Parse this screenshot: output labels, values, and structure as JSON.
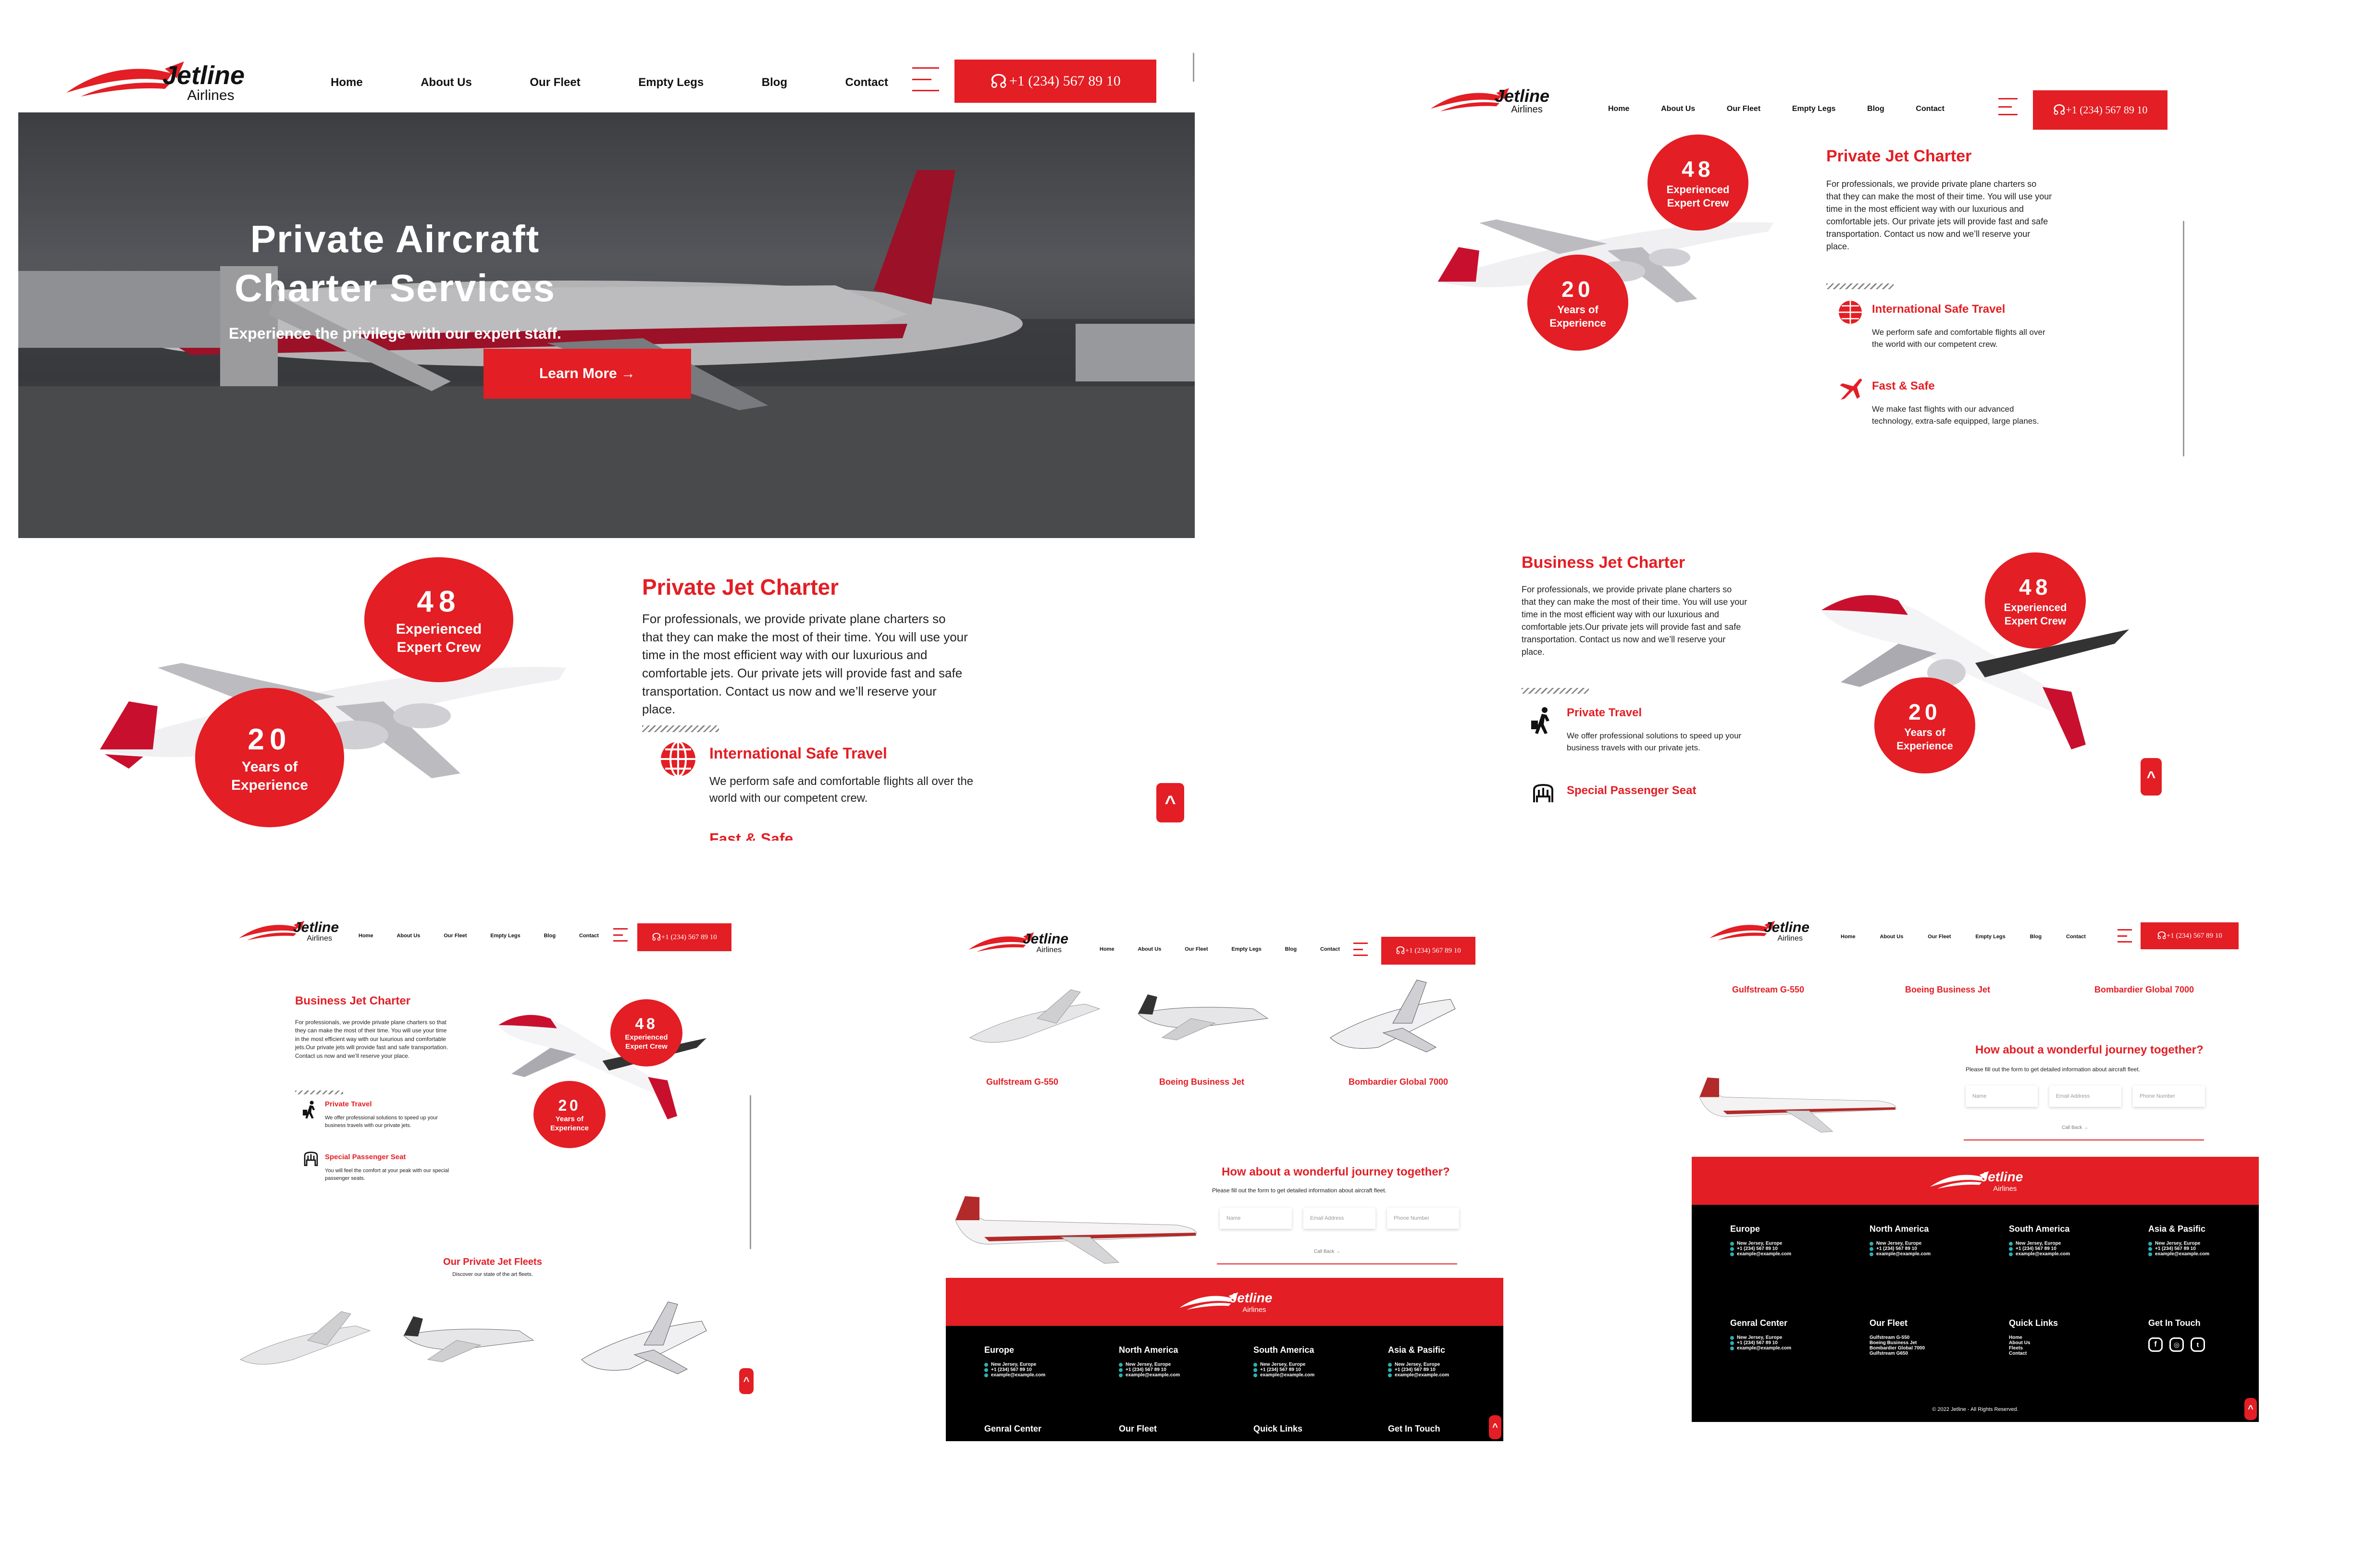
{
  "brand": {
    "name": "Jetline",
    "sub": "Airlines"
  },
  "nav": {
    "items": [
      "Home",
      "About Us",
      "Our Fleet",
      "Empty Legs",
      "Blog",
      "Contact"
    ],
    "phone": "+1 (234) 567 89 10"
  },
  "hero": {
    "title_line1": "Private Aircraft",
    "title_line2": "Charter Services",
    "subtitle": "Experience the privilege with our expert staff.",
    "button": "Learn More →"
  },
  "stats": {
    "crew_num": "48",
    "crew_label1": "Experienced",
    "crew_label2": "Expert Crew",
    "years_num": "20",
    "years_label1": "Years of",
    "years_label2": "Experience"
  },
  "private": {
    "title": "Private Jet Charter",
    "text": "For professionals, we provide private plane charters so that they can make the most of their time. You will use your time in the most efficient way with our luxurious and comfortable jets. Our private jets will provide fast and safe transportation. Contact us now and we’ll reserve your place.",
    "f1_title": "International Safe Travel",
    "f1_text": "We perform safe and comfortable flights all over the world with our competent crew.",
    "f2_title": "Fast & Safe",
    "f2_text": "We make fast flights with our advanced technology, extra-safe equipped, large planes."
  },
  "business": {
    "title": "Business Jet Charter",
    "text": "For professionals, we provide private plane charters so that they can make the most of their time. You will use your time in the most efficient way with our luxurious and comfortable jets.Our private jets will provide fast and safe transportation. Contact us now and we’ll reserve your place.",
    "f1_title": "Private Travel",
    "f1_text": "We offer professional solutions to speed up your business travels with our private jets.",
    "f2_title": "Special Passenger Seat",
    "f2_text": "You will feel the comfort at your peak with our special passenger seats."
  },
  "fleets": {
    "title": "Our Private Jet Fleets",
    "subtitle": "Discover our state of the art fleets.",
    "names": [
      "Gulfstream G-550",
      "Boeing Business Jet",
      "Bombardier Global 7000"
    ]
  },
  "journey": {
    "title": "How about a wonderful journey together?",
    "text": "Please fill out the form to get detailed information about aircraft fleet.",
    "name_ph": "Name",
    "email_ph": "Email Address",
    "phone_ph": "Phone Number",
    "button": "Call Back →"
  },
  "footer": {
    "regions": [
      {
        "title": "Europe",
        "addr": "New Jersey, Europe",
        "phone": "+1 (234) 567 89 10",
        "email": "example@example.com"
      },
      {
        "title": "North America",
        "addr": "New Jersey, Europe",
        "phone": "+1 (234) 567 89 10",
        "email": "example@example.com"
      },
      {
        "title": "South America",
        "addr": "New Jersey, Europe",
        "phone": "+1 (234) 567 89 10",
        "email": "example@example.com"
      },
      {
        "title": "Asia & Pasific",
        "addr": "New Jersey, Europe",
        "phone": "+1 (234) 567 89 10",
        "email": "example@example.com"
      }
    ],
    "center": {
      "title": "Genral Center",
      "addr": "New Jersey, Europe",
      "phone": "+1 (234) 567 89 10",
      "email": "example@example.com"
    },
    "fleet": {
      "title": "Our Fleet",
      "items": [
        "Gulfstream G-550",
        "Boeing Business Jet",
        "Bombardier Global 7000",
        "Gulfstream G650"
      ]
    },
    "links": {
      "title": "Quick Links",
      "items": [
        "Home",
        "About Us",
        "Fleets",
        "Contact"
      ]
    },
    "touch": {
      "title": "Get In Touch"
    },
    "copyright": "© 2022 Jetline - All Rights Reserved."
  },
  "colors": {
    "accent": "#e31e24",
    "footer": "#000000"
  },
  "icons": [
    "headset-icon",
    "globe-icon",
    "plane-icon",
    "traveler-icon",
    "seat-icon",
    "location-icon",
    "phone-icon",
    "mail-icon",
    "facebook-icon",
    "instagram-icon",
    "twitter-icon",
    "chevron-up-icon",
    "menu-icon"
  ]
}
